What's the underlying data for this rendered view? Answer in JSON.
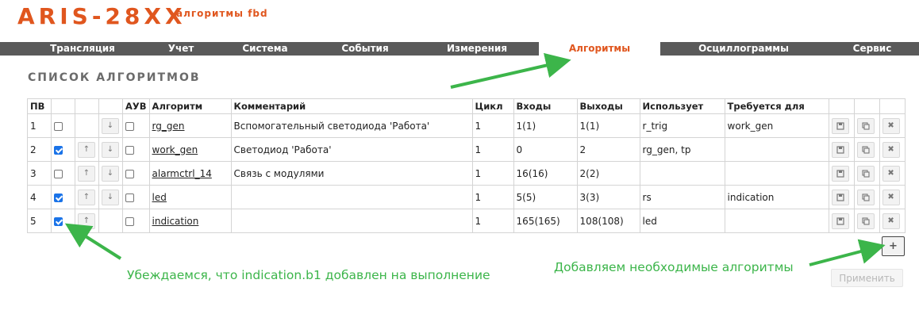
{
  "brand": {
    "title": "ARIS-28XX",
    "subtitle": "алгоритмы fbd"
  },
  "nav": {
    "tabs": [
      {
        "label": "Трансляция",
        "active": false
      },
      {
        "label": "Учет",
        "active": false
      },
      {
        "label": "Система",
        "active": false
      },
      {
        "label": "События",
        "active": false
      },
      {
        "label": "Измерения",
        "active": false
      },
      {
        "label": "Алгоритмы",
        "active": true
      },
      {
        "label": "Осциллограммы",
        "active": false
      },
      {
        "label": "Сервис",
        "active": false
      }
    ]
  },
  "section": {
    "title": "СПИСОК АЛГОРИТМОВ"
  },
  "table": {
    "headers": {
      "pv": "ПВ",
      "auv": "АУВ",
      "algorithm": "Алгоритм",
      "comment": "Комментарий",
      "cycle": "Цикл",
      "inputs": "Входы",
      "outputs": "Выходы",
      "uses": "Использует",
      "required_by": "Требуется для"
    },
    "rows": [
      {
        "pv": "1",
        "enabled": false,
        "up": false,
        "down": true,
        "auv": false,
        "algorithm": "rg_gen",
        "comment": "Вспомогательный светодиода 'Работа'",
        "cycle": "1",
        "inputs": "1(1)",
        "outputs": "1(1)",
        "uses": "r_trig",
        "required_by": "work_gen"
      },
      {
        "pv": "2",
        "enabled": true,
        "up": true,
        "down": true,
        "auv": false,
        "algorithm": "work_gen",
        "comment": "Светодиод 'Работа'",
        "cycle": "1",
        "inputs": "0",
        "outputs": "2",
        "uses": "rg_gen, tp",
        "required_by": ""
      },
      {
        "pv": "3",
        "enabled": false,
        "up": true,
        "down": true,
        "auv": false,
        "algorithm": "alarmctrl_14",
        "comment": "Связь с модулями",
        "cycle": "1",
        "inputs": "16(16)",
        "outputs": "2(2)",
        "uses": "",
        "required_by": ""
      },
      {
        "pv": "4",
        "enabled": true,
        "up": true,
        "down": true,
        "auv": false,
        "algorithm": "led",
        "comment": "",
        "cycle": "1",
        "inputs": "5(5)",
        "outputs": "3(3)",
        "uses": "rs",
        "required_by": "indication"
      },
      {
        "pv": "5",
        "enabled": true,
        "up": true,
        "down": false,
        "auv": false,
        "algorithm": "indication",
        "comment": "",
        "cycle": "1",
        "inputs": "165(165)",
        "outputs": "108(108)",
        "uses": "led",
        "required_by": ""
      }
    ],
    "icons": {
      "up": "arrow-up-icon",
      "down": "arrow-down-icon",
      "save": "save-icon",
      "copy": "copy-icon",
      "delete": "close-icon"
    }
  },
  "actions": {
    "add_label": "+",
    "apply_label": "Применить"
  },
  "annotations": {
    "left_note": "Убеждаемся, что indication.b1 добавлен на выполнение",
    "right_note": "Добавляем необходимые алгоритмы",
    "color": "#3cb54a"
  },
  "colors": {
    "brand": "#e0561e",
    "nav_bg": "#5a5a5a",
    "checkbox": "#1a73e8"
  }
}
